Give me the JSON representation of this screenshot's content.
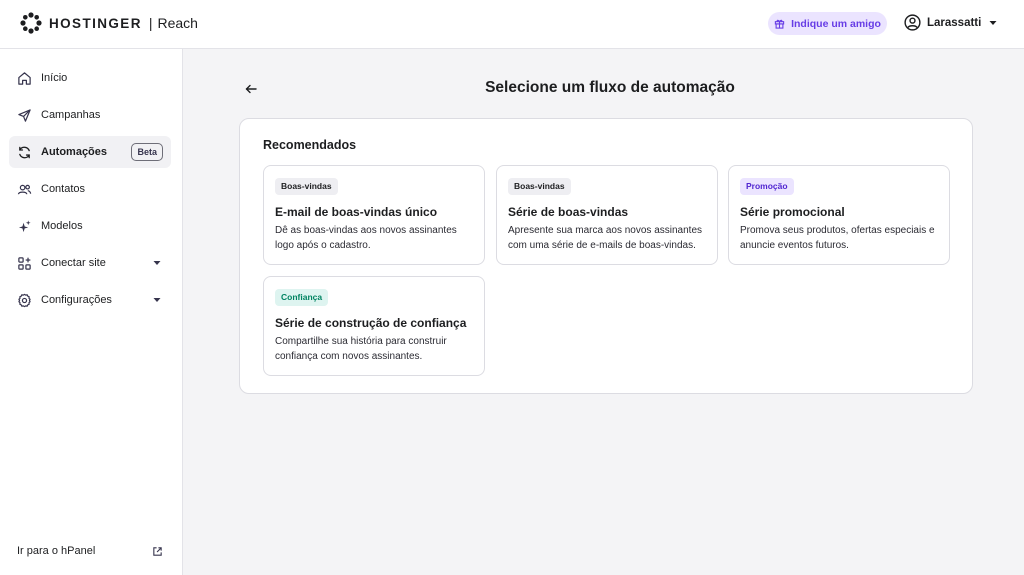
{
  "header": {
    "brand": "HOSTINGER",
    "separator": "|",
    "product": "Reach",
    "refer_label": "Indique um amigo",
    "username": "Larassatti"
  },
  "sidebar": {
    "items": [
      {
        "label": "Início",
        "icon": "home-icon"
      },
      {
        "label": "Campanhas",
        "icon": "send-icon"
      },
      {
        "label": "Automações",
        "icon": "refresh-icon",
        "badge": "Beta",
        "active": true
      },
      {
        "label": "Contatos",
        "icon": "users-icon"
      },
      {
        "label": "Modelos",
        "icon": "sparkle-icon"
      },
      {
        "label": "Conectar site",
        "icon": "grid-plus-icon",
        "expandable": true
      },
      {
        "label": "Configurações",
        "icon": "gear-icon",
        "expandable": true
      }
    ],
    "footer_link": "Ir para o hPanel"
  },
  "main": {
    "title": "Selecione um fluxo de automação",
    "section_title": "Recomendados",
    "cards": [
      {
        "tag": "Boas-vindas",
        "title": "E-mail de boas-vindas único",
        "desc_line1": "Dê as boas-vindas aos novos assinantes",
        "desc_line2": "logo após o cadastro."
      },
      {
        "tag": "Boas-vindas",
        "title": "Série de boas-vindas",
        "desc_line1": "Apresente sua marca aos novos assinantes",
        "desc_line2": "com uma série de e-mails de boas-vindas."
      },
      {
        "tag": "Promoção",
        "title": "Série promocional",
        "desc_line1": "Promova seus produtos, ofertas especiais e",
        "desc_line2": "anuncie eventos futuros."
      },
      {
        "tag": "Confiança",
        "title": "Série de construção de confiança",
        "desc_line1": "Compartilhe sua história para construir",
        "desc_line2": "confiança com novos assinantes."
      }
    ]
  },
  "colors": {
    "accent": "#673de6",
    "accent_bg": "#ebe4ff",
    "success": "#008361",
    "success_bg": "#def4f0",
    "page_bg": "#f4f4f6"
  }
}
